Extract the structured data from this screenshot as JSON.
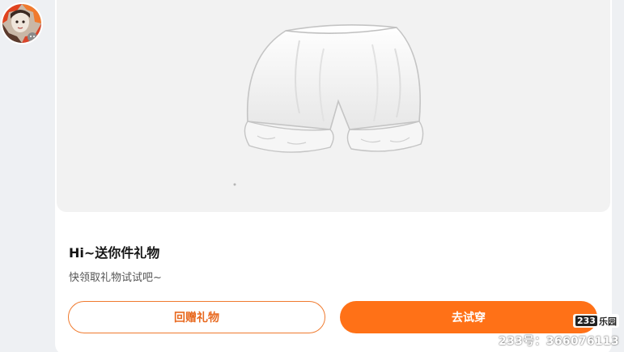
{
  "card": {
    "title": "Hi~送你件礼物",
    "subtitle": "快领取礼物试试吧~",
    "return_gift_label": "回赠礼物",
    "try_on_label": "去试穿"
  },
  "gift": {
    "item": "pumpkin-shorts-illustration"
  },
  "watermark": {
    "logo_number": "233",
    "logo_text": "乐园",
    "account_id": "233号：366076113"
  },
  "colors": {
    "accent": "#ff7117",
    "accent_text": "#e8691f",
    "page_background": "#eef0f3",
    "card_background": "#ffffff",
    "image_background": "#f2f2f2"
  }
}
